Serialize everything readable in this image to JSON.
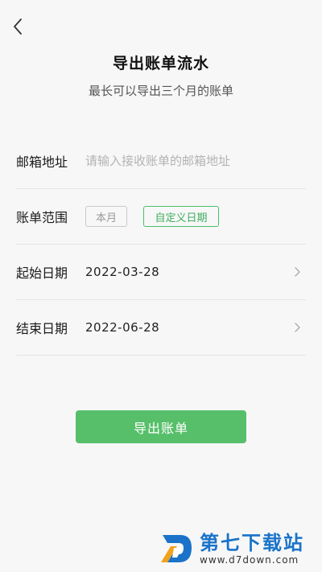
{
  "header": {
    "back_icon": "chevron-left-icon",
    "title": "导出账单流水",
    "subtitle": "最长可以导出三个月的账单"
  },
  "form": {
    "email": {
      "label": "邮箱地址",
      "value": "",
      "placeholder": "请输入接收账单的邮箱地址"
    },
    "range": {
      "label": "账单范围",
      "options": [
        "本月",
        "自定义日期"
      ],
      "selected": "自定义日期"
    },
    "start": {
      "label": "起始日期",
      "value": "2022-03-28"
    },
    "end": {
      "label": "结束日期",
      "value": "2022-06-28"
    }
  },
  "actions": {
    "export_label": "导出账单"
  },
  "watermark": {
    "name": "第七下载站",
    "url": "www.d7down.com"
  },
  "colors": {
    "accent": "#57bf6a",
    "background": "#f7f7f7",
    "watermark_blue": "#1a73c9"
  }
}
